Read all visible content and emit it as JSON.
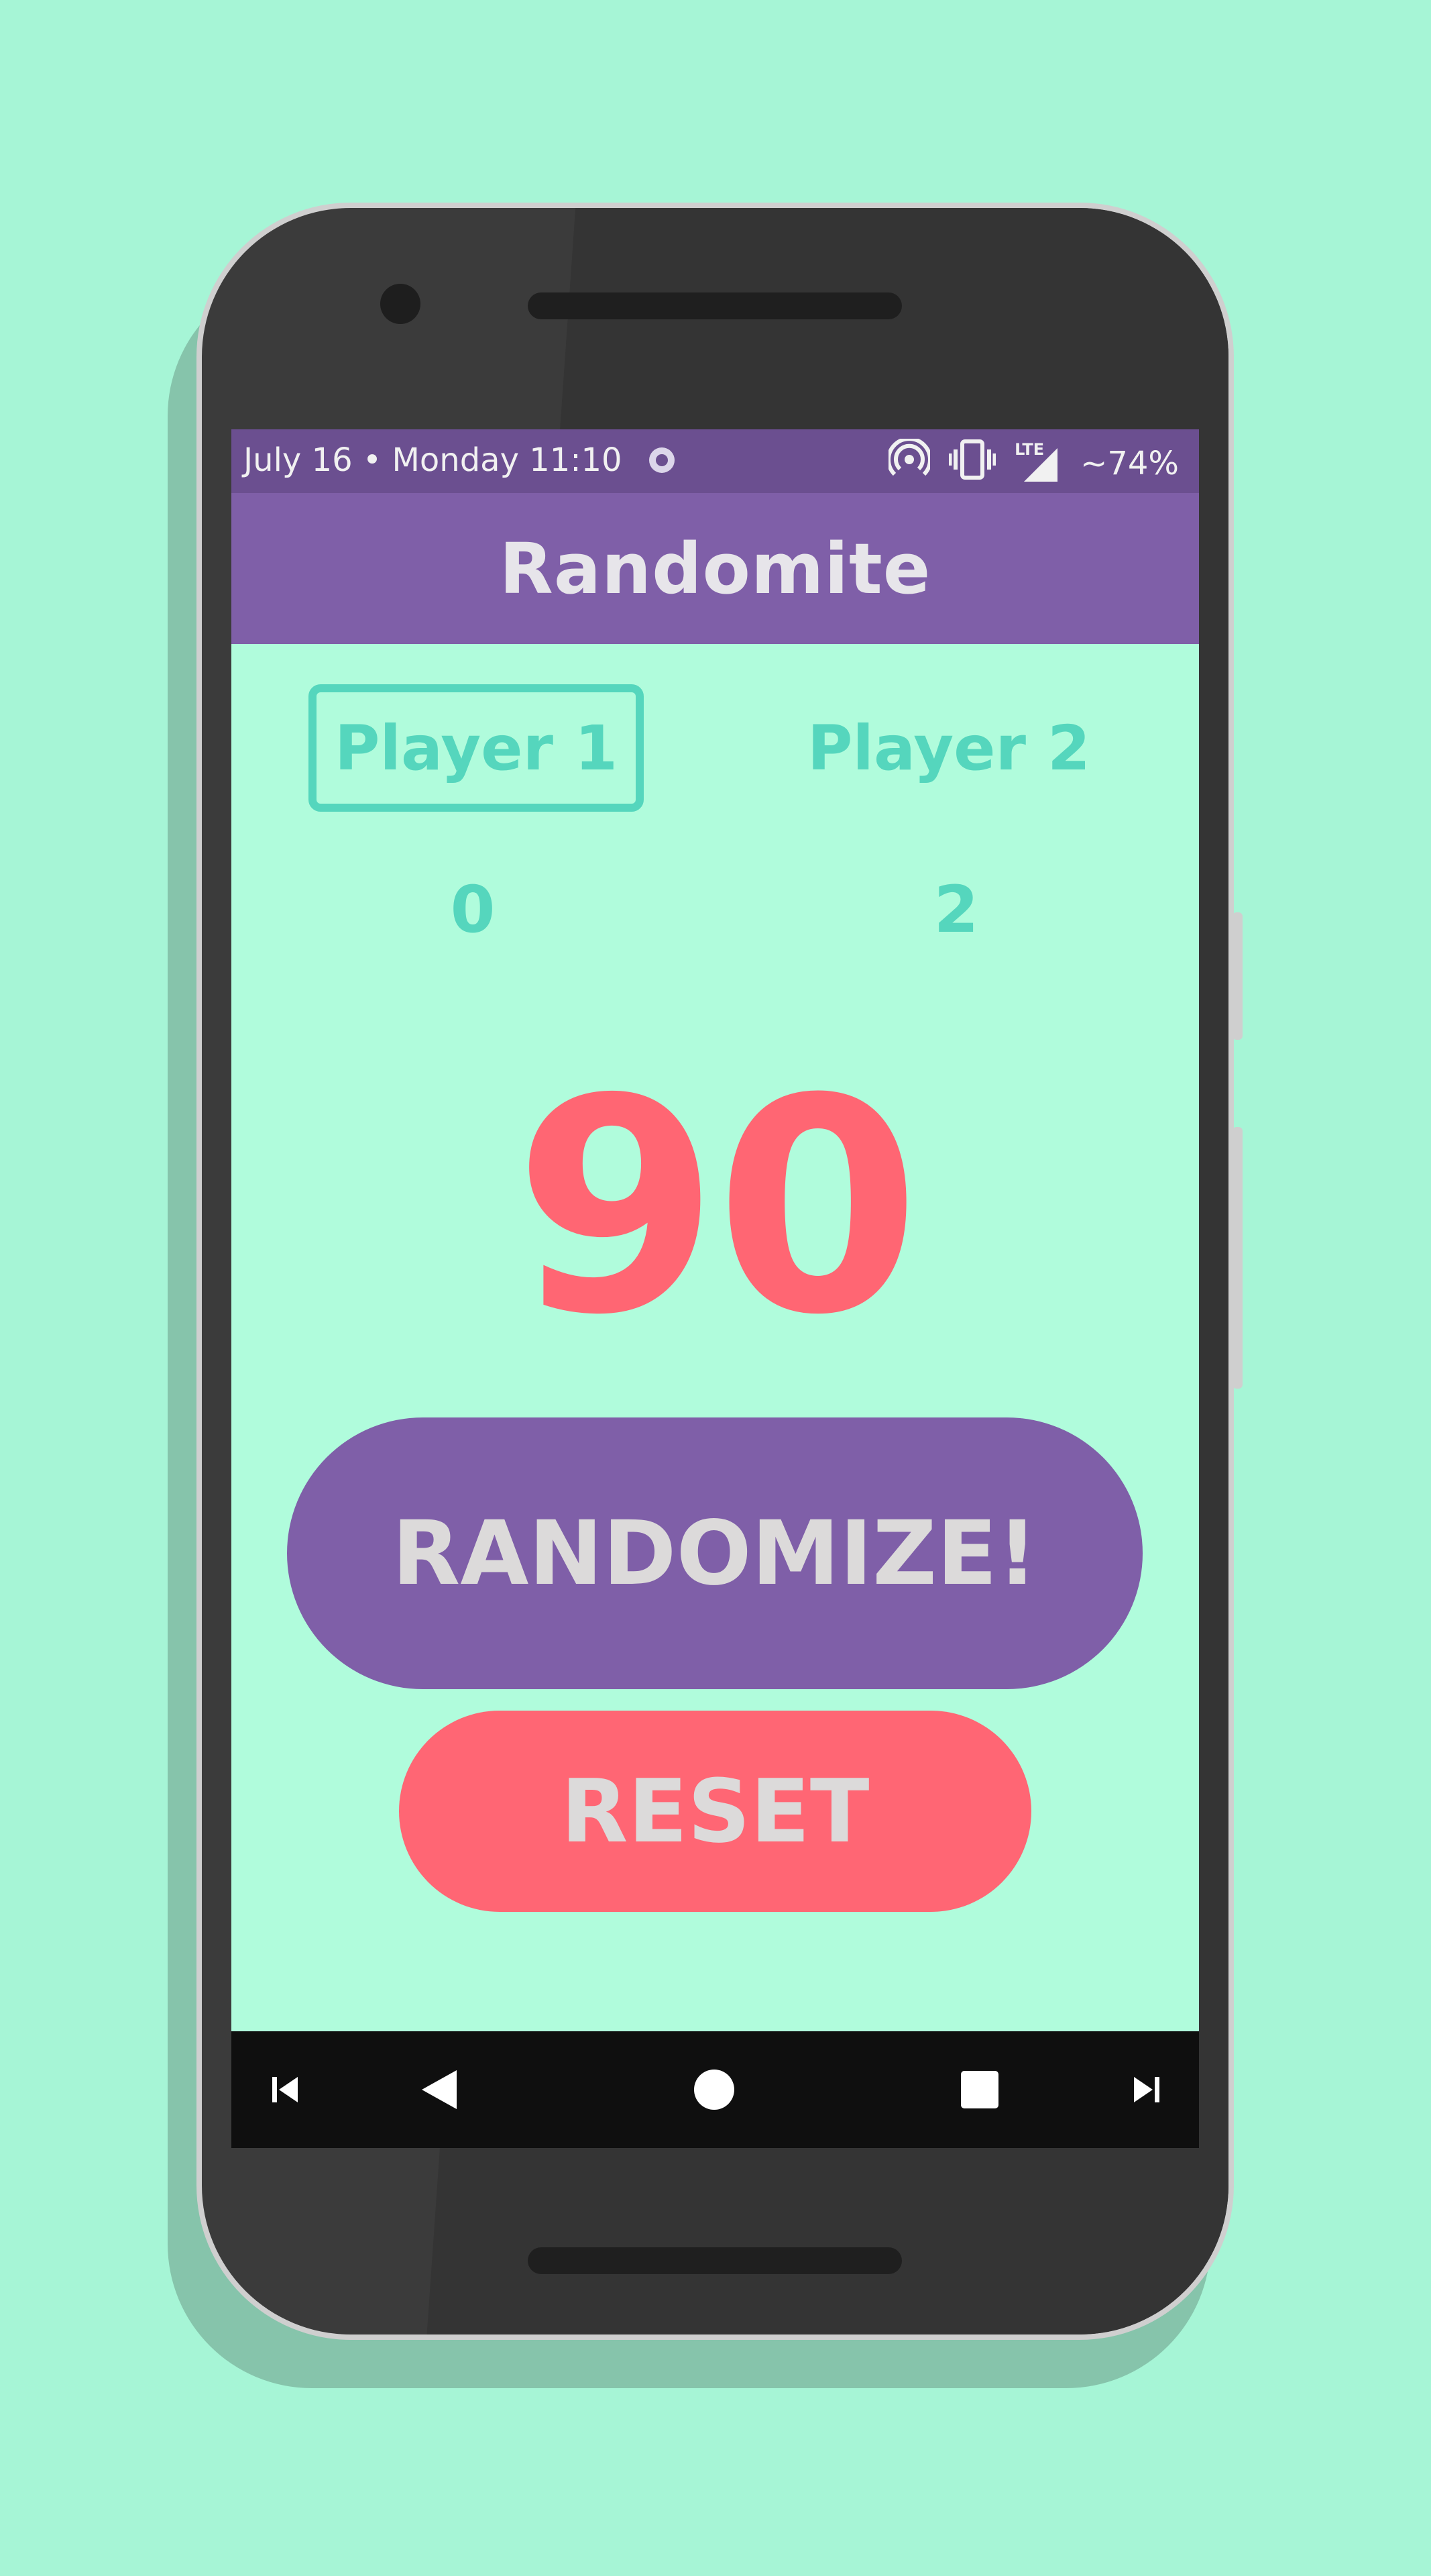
{
  "status_bar": {
    "date_time": "July 16 • Monday 11:10",
    "network_type": "LTE",
    "battery": "~74%",
    "icons": [
      "notification-dot-icon",
      "hotspot-icon",
      "vibrate-icon",
      "lte-signal-icon"
    ]
  },
  "app_bar": {
    "title": "Randomite"
  },
  "players": [
    {
      "label": "Player 1",
      "score": "0",
      "selected": true
    },
    {
      "label": "Player 2",
      "score": "2",
      "selected": false
    }
  ],
  "random_number": "90",
  "buttons": {
    "randomize": "RANDOMIZE!",
    "reset": "RESET"
  },
  "nav_bar": {
    "icons": [
      "skip-previous-icon",
      "back-icon",
      "home-icon",
      "recents-icon",
      "skip-next-icon"
    ]
  },
  "colors": {
    "background": "#a6f5d6",
    "screen": "#b0fcdc",
    "purple": "#7f5fa8",
    "coral": "#ff6673",
    "teal": "#55d6bd"
  }
}
